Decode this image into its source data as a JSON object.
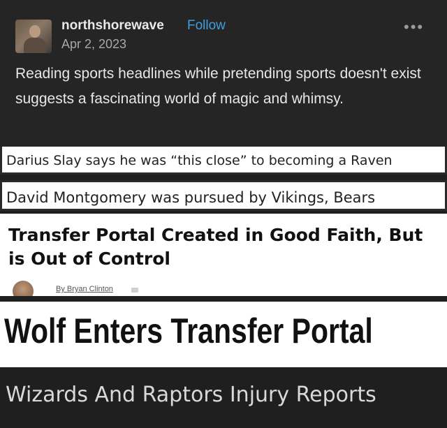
{
  "post": {
    "username": "northshorewave",
    "follow_label": "Follow",
    "date": "Apr 2, 2023",
    "more_icon": "•••",
    "text": "Reading sports headlines while pretending sports doesn't exist suggests a fascinating world of magic and whimsy."
  },
  "headlines": [
    {
      "text": "Darius Slay says he was “this close” to becoming a Raven"
    },
    {
      "text": "David Montgomery was pursued by Vikings, Bears"
    },
    {
      "text": "Transfer Portal Created in Good Faith, But is Out of Control",
      "byline": "By Bryan Clinton"
    },
    {
      "text": "Wolf Enters Transfer Portal"
    },
    {
      "text": "Wizards And Raptors Injury Reports"
    }
  ]
}
